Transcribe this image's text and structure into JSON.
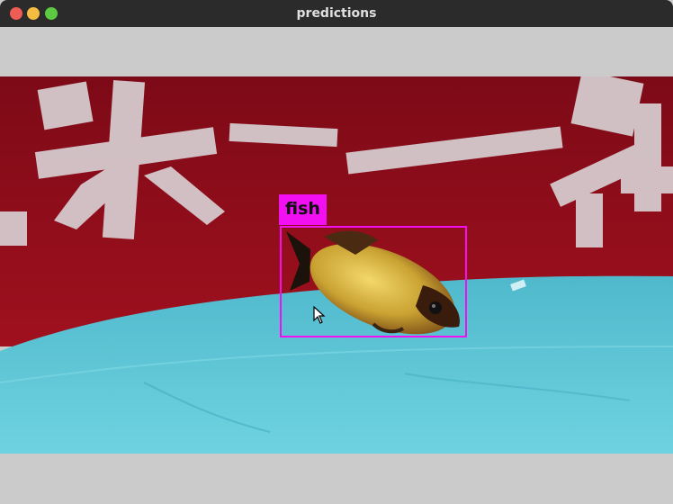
{
  "window": {
    "title": "predictions",
    "controls": [
      "close",
      "minimize",
      "maximize"
    ]
  },
  "detection": {
    "label": "fish",
    "color": "#f20ff2"
  },
  "cursor": "arrow-pointer"
}
